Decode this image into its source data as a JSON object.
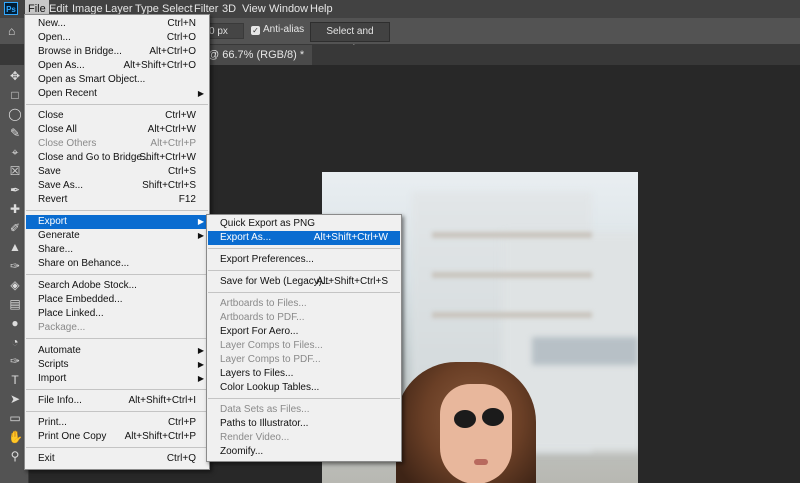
{
  "app": {
    "logo": "Ps"
  },
  "menubar": [
    {
      "label": "File",
      "active": true
    },
    {
      "label": "Edit"
    },
    {
      "label": "Image"
    },
    {
      "label": "Layer"
    },
    {
      "label": "Type"
    },
    {
      "label": "Select"
    },
    {
      "label": "Filter"
    },
    {
      "label": "3D"
    },
    {
      "label": "View"
    },
    {
      "label": "Window"
    },
    {
      "label": "Help"
    }
  ],
  "options": {
    "feather_value": "0 px",
    "anti_alias_label": "Anti-alias",
    "anti_alias_checked": true,
    "select_mask_label": "Select and Mask..."
  },
  "document_tab": {
    "label": "@ 66.7% (RGB/8) *"
  },
  "file_menu": {
    "items": [
      {
        "label": "New...",
        "shortcut": "Ctrl+N"
      },
      {
        "label": "Open...",
        "shortcut": "Ctrl+O"
      },
      {
        "label": "Browse in Bridge...",
        "shortcut": "Alt+Ctrl+O"
      },
      {
        "label": "Open As...",
        "shortcut": "Alt+Shift+Ctrl+O"
      },
      {
        "label": "Open as Smart Object...",
        "shortcut": ""
      },
      {
        "label": "Open Recent",
        "shortcut": "",
        "submenu": true
      },
      {
        "label": "Close",
        "shortcut": "Ctrl+W"
      },
      {
        "label": "Close All",
        "shortcut": "Alt+Ctrl+W"
      },
      {
        "label": "Close Others",
        "shortcut": "Alt+Ctrl+P",
        "disabled": true
      },
      {
        "label": "Close and Go to Bridge...",
        "shortcut": "Shift+Ctrl+W"
      },
      {
        "label": "Save",
        "shortcut": "Ctrl+S"
      },
      {
        "label": "Save As...",
        "shortcut": "Shift+Ctrl+S"
      },
      {
        "label": "Revert",
        "shortcut": "F12"
      },
      {
        "label": "Export",
        "shortcut": "",
        "submenu": true,
        "selected": true
      },
      {
        "label": "Generate",
        "shortcut": "",
        "submenu": true
      },
      {
        "label": "Share...",
        "shortcut": ""
      },
      {
        "label": "Share on Behance...",
        "shortcut": ""
      },
      {
        "label": "Search Adobe Stock...",
        "shortcut": ""
      },
      {
        "label": "Place Embedded...",
        "shortcut": ""
      },
      {
        "label": "Place Linked...",
        "shortcut": ""
      },
      {
        "label": "Package...",
        "shortcut": "",
        "disabled": true
      },
      {
        "label": "Automate",
        "shortcut": "",
        "submenu": true
      },
      {
        "label": "Scripts",
        "shortcut": "",
        "submenu": true
      },
      {
        "label": "Import",
        "shortcut": "",
        "submenu": true
      },
      {
        "label": "File Info...",
        "shortcut": "Alt+Shift+Ctrl+I"
      },
      {
        "label": "Print...",
        "shortcut": "Ctrl+P"
      },
      {
        "label": "Print One Copy",
        "shortcut": "Alt+Shift+Ctrl+P"
      },
      {
        "label": "Exit",
        "shortcut": "Ctrl+Q"
      }
    ]
  },
  "export_menu": {
    "items": [
      {
        "label": "Quick Export as PNG",
        "shortcut": ""
      },
      {
        "label": "Export As...",
        "shortcut": "Alt+Shift+Ctrl+W",
        "selected": true
      },
      {
        "label": "Export Preferences...",
        "shortcut": ""
      },
      {
        "label": "Save for Web (Legacy)...",
        "shortcut": "Alt+Shift+Ctrl+S"
      },
      {
        "label": "Artboards to Files...",
        "shortcut": "",
        "disabled": true
      },
      {
        "label": "Artboards to PDF...",
        "shortcut": "",
        "disabled": true
      },
      {
        "label": "Export For Aero...",
        "shortcut": ""
      },
      {
        "label": "Layer Comps to Files...",
        "shortcut": "",
        "disabled": true
      },
      {
        "label": "Layer Comps to PDF...",
        "shortcut": "",
        "disabled": true
      },
      {
        "label": "Layers to Files...",
        "shortcut": ""
      },
      {
        "label": "Color Lookup Tables...",
        "shortcut": ""
      },
      {
        "label": "Data Sets as Files...",
        "shortcut": "",
        "disabled": true
      },
      {
        "label": "Paths to Illustrator...",
        "shortcut": ""
      },
      {
        "label": "Render Video...",
        "shortcut": "",
        "disabled": true
      },
      {
        "label": "Zoomify...",
        "shortcut": ""
      }
    ]
  },
  "toolbar_icons": [
    "move-icon",
    "marquee-icon",
    "lasso-icon",
    "quick-select-icon",
    "crop-icon",
    "frame-icon",
    "eyedropper-icon",
    "healing-icon",
    "brush-icon",
    "clone-stamp-icon",
    "history-brush-icon",
    "eraser-icon",
    "gradient-icon",
    "blur-icon",
    "dodge-icon",
    "pen-icon",
    "type-icon",
    "path-select-icon",
    "rectangle-icon",
    "hand-icon",
    "zoom-icon"
  ],
  "colors": {
    "menu_bg": "#f0f0f0",
    "highlight": "#0a6cd0",
    "ui_dark": "#535353",
    "canvas": "#282828"
  }
}
